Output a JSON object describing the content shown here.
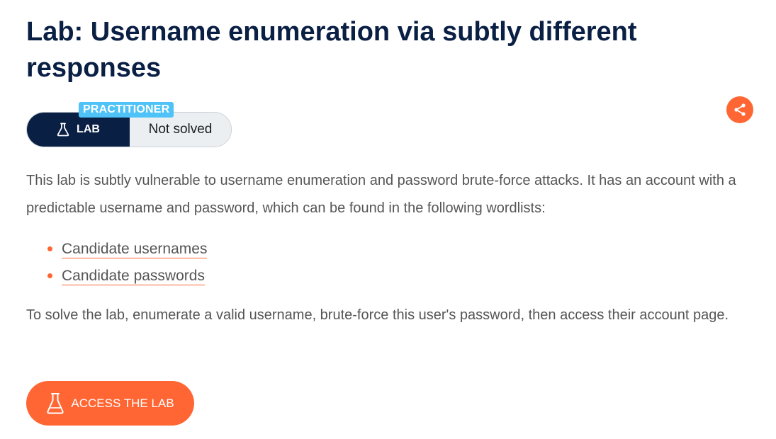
{
  "page": {
    "title": "Lab: Username enumeration via subtly different responses"
  },
  "badge": {
    "level": "PRACTITIONER",
    "type_label": "LAB",
    "status": "Not solved",
    "icon": "flask-icon"
  },
  "share": {
    "icon": "share-icon"
  },
  "description": {
    "intro": "This lab is subtly vulnerable to username enumeration and password brute-force attacks. It has an account with a predictable username and password, which can be found in the following wordlists:",
    "wordlists": [
      {
        "label": "Candidate usernames"
      },
      {
        "label": "Candidate passwords"
      }
    ],
    "solve": "To solve the lab, enumerate a valid username, brute-force this user's password, then access their account page."
  },
  "cta": {
    "label": "ACCESS THE LAB",
    "icon": "flask-icon"
  },
  "colors": {
    "heading": "#0a1f44",
    "accent": "#ff6633",
    "level_badge": "#4fc3f7",
    "pill_dark": "#0a1f44",
    "pill_light": "#ebeff2",
    "body_text": "#555555"
  }
}
